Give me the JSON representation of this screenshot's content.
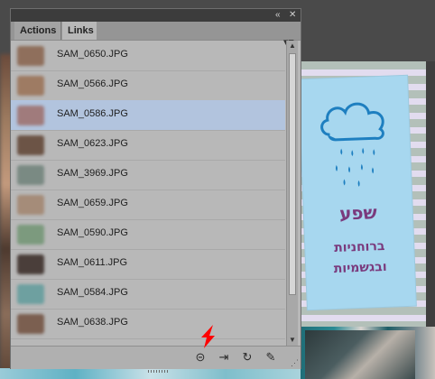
{
  "panel": {
    "tabs": [
      {
        "label": "Actions"
      },
      {
        "label": "Links"
      }
    ],
    "collapse_icon": "double-chevron-left-icon",
    "close_icon": "close-icon",
    "menu_icon": "panel-menu-icon",
    "links": [
      {
        "name": "SAM_0650.JPG",
        "thumb": "#8f6f5c"
      },
      {
        "name": "SAM_0566.JPG",
        "thumb": "#9e7b63"
      },
      {
        "name": "SAM_0586.JPG",
        "thumb": "#a07b7c",
        "selected": true
      },
      {
        "name": "SAM_0623.JPG",
        "thumb": "#6c5446"
      },
      {
        "name": "SAM_3969.JPG",
        "thumb": "#7a8a83"
      },
      {
        "name": "SAM_0659.JPG",
        "thumb": "#a58c79"
      },
      {
        "name": "SAM_0590.JPG",
        "thumb": "#7c9a7e"
      },
      {
        "name": "SAM_0611.JPG",
        "thumb": "#4a3e3a"
      },
      {
        "name": "SAM_0584.JPG",
        "thumb": "#6ea0a0"
      },
      {
        "name": "SAM_0638.JPG",
        "thumb": "#7b5f50"
      }
    ],
    "toolbar": {
      "relink_icon": "link-icon",
      "goto_link_icon": "goto-link-icon",
      "update_link_icon": "refresh-icon",
      "edit_original_icon": "pencil-icon"
    },
    "selected_color": "#b2c4de"
  },
  "document": {
    "title": "שפע",
    "line1": "ברוחניות",
    "line2": "ובגשמיות",
    "card_color": "#a7d7ef",
    "text_color": "#7a3a7d"
  },
  "annotation": {
    "arrow_color": "#ff0000"
  }
}
